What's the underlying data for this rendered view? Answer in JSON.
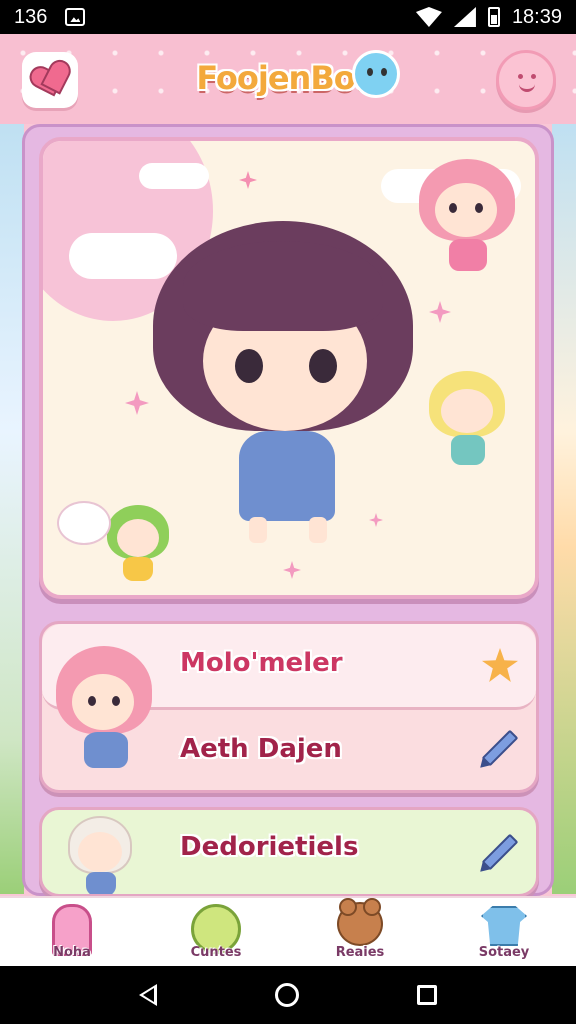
{
  "status_bar": {
    "left_text": "136",
    "time": "18:39",
    "icons": [
      "image-icon",
      "wifi-icon",
      "signal-icon",
      "battery-icon"
    ]
  },
  "header": {
    "title": "FoojenBoo",
    "left_button_icon": "heart-eraser-icon",
    "right_button_icon": "smile-face-icon"
  },
  "hero": {
    "characters": [
      "main-chibi-girl",
      "pink-hair-chibi",
      "blonde-chibi",
      "green-hair-chibi",
      "white-bunny"
    ]
  },
  "list": {
    "items": [
      {
        "label": "Molo'meler",
        "icon": "star-icon"
      },
      {
        "label": "Aeth Dajen",
        "icon": "pencil-icon"
      },
      {
        "label": "Dedorietiels",
        "icon": "pencil-icon"
      }
    ]
  },
  "bottom_nav": {
    "items": [
      {
        "label": "Noha",
        "icon": "house-icon"
      },
      {
        "label": "Cuntes",
        "icon": "cup-icon"
      },
      {
        "label": "Reaies",
        "icon": "bear-icon"
      },
      {
        "label": "Sotaey",
        "icon": "shirt-icon"
      }
    ]
  },
  "colors": {
    "header_bg": "#f8bfd1",
    "panel_bg": "#e5b8e2",
    "label_pink": "#cc3763",
    "row_green": "#e9f6d4"
  }
}
